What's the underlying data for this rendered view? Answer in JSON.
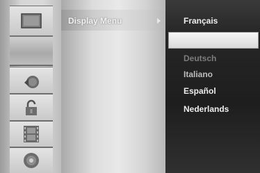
{
  "menu": {
    "title": "Display Menu"
  },
  "sidebar": {
    "items": [
      {
        "icon": "tv-icon",
        "selected": false
      },
      {
        "icon": "blank-icon",
        "selected": true
      },
      {
        "icon": "speaker-icon",
        "selected": false
      },
      {
        "icon": "lock-icon",
        "selected": false
      },
      {
        "icon": "film-icon",
        "selected": false
      },
      {
        "icon": "disc-icon",
        "selected": false
      }
    ]
  },
  "languages": {
    "items": [
      {
        "label": "Français",
        "state": "normal"
      },
      {
        "label": "",
        "state": "highlighted"
      },
      {
        "label": "Deutsch",
        "state": "faded"
      },
      {
        "label": "Italiano",
        "state": "dim"
      },
      {
        "label": "Español",
        "state": "normal"
      },
      {
        "label": "Nederlands",
        "state": "normal"
      }
    ]
  }
}
